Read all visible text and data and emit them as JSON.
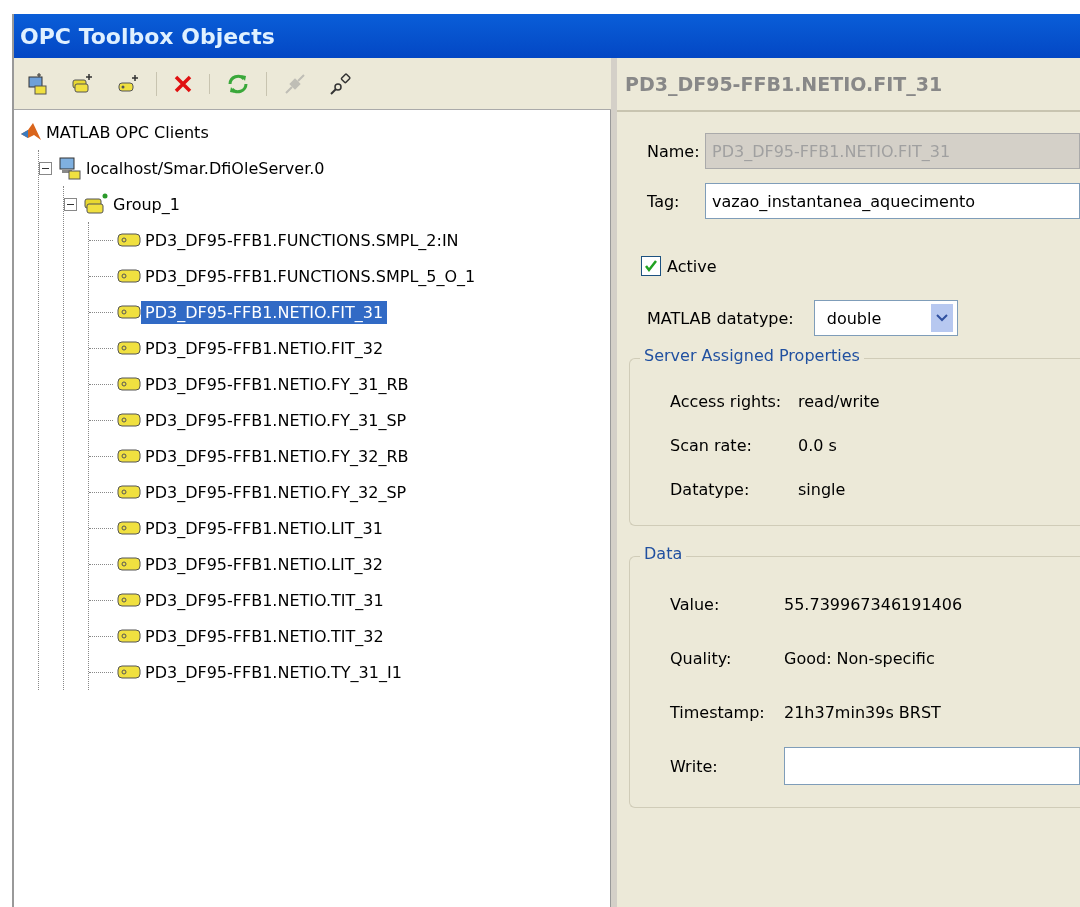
{
  "window": {
    "title": "OPC Toolbox Objects"
  },
  "toolbar": [
    [
      {
        "kind": "new-client",
        "disabled": false
      },
      {
        "kind": "add-group",
        "disabled": false
      },
      {
        "kind": "add-item",
        "disabled": false
      }
    ],
    [
      {
        "kind": "delete",
        "disabled": false
      }
    ],
    [
      {
        "kind": "refresh",
        "disabled": false
      }
    ],
    [
      {
        "kind": "disconnect",
        "disabled": true
      },
      {
        "kind": "connect",
        "disabled": false
      }
    ]
  ],
  "tree": {
    "kind": "root",
    "label": "MATLAB OPC Clients",
    "children": [
      {
        "kind": "server",
        "label": "localhost/Smar.DfiOleServer.0",
        "expanded": true,
        "children": [
          {
            "kind": "group",
            "label": "Group_1",
            "expanded": true,
            "children": [
              {
                "kind": "item",
                "label": "PD3_DF95-FFB1.FUNCTIONS.SMPL_2:IN",
                "selected": false
              },
              {
                "kind": "item",
                "label": "PD3_DF95-FFB1.FUNCTIONS.SMPL_5_O_1",
                "selected": false
              },
              {
                "kind": "item",
                "label": "PD3_DF95-FFB1.NETIO.FIT_31",
                "selected": true
              },
              {
                "kind": "item",
                "label": "PD3_DF95-FFB1.NETIO.FIT_32",
                "selected": false
              },
              {
                "kind": "item",
                "label": "PD3_DF95-FFB1.NETIO.FY_31_RB",
                "selected": false
              },
              {
                "kind": "item",
                "label": "PD3_DF95-FFB1.NETIO.FY_31_SP",
                "selected": false
              },
              {
                "kind": "item",
                "label": "PD3_DF95-FFB1.NETIO.FY_32_RB",
                "selected": false
              },
              {
                "kind": "item",
                "label": "PD3_DF95-FFB1.NETIO.FY_32_SP",
                "selected": false
              },
              {
                "kind": "item",
                "label": "PD3_DF95-FFB1.NETIO.LIT_31",
                "selected": false
              },
              {
                "kind": "item",
                "label": "PD3_DF95-FFB1.NETIO.LIT_32",
                "selected": false
              },
              {
                "kind": "item",
                "label": "PD3_DF95-FFB1.NETIO.TIT_31",
                "selected": false
              },
              {
                "kind": "item",
                "label": "PD3_DF95-FFB1.NETIO.TIT_32",
                "selected": false
              },
              {
                "kind": "item",
                "label": "PD3_DF95-FFB1.NETIO.TY_31_I1",
                "selected": false
              }
            ]
          }
        ]
      }
    ]
  },
  "details": {
    "title": "PD3_DF95-FFB1.NETIO.FIT_31",
    "name": {
      "label": "Name:",
      "value": "PD3_DF95-FFB1.NETIO.FIT_31",
      "disabled": true
    },
    "tag": {
      "label": "Tag:",
      "value": "vazao_instantanea_aquecimento"
    },
    "active": {
      "label": "Active",
      "checked": true
    },
    "datatype": {
      "label": "MATLAB datatype:",
      "value": "double"
    },
    "sections": [
      {
        "title": "Server Assigned Properties",
        "rows": [
          {
            "label": "Access rights:",
            "value": "read/write"
          },
          {
            "label": "Scan rate:",
            "value": "0.0 s"
          },
          {
            "label": "Datatype:",
            "value": "single"
          }
        ]
      },
      {
        "title": "Data",
        "rows": [
          {
            "label": "Value:",
            "value": "55.739967346191406"
          },
          {
            "label": "Quality:",
            "value": "Good: Non-specific"
          },
          {
            "label": "Timestamp:",
            "value": "21h37min39s BRST"
          }
        ],
        "write": {
          "label": "Write:"
        }
      }
    ]
  }
}
